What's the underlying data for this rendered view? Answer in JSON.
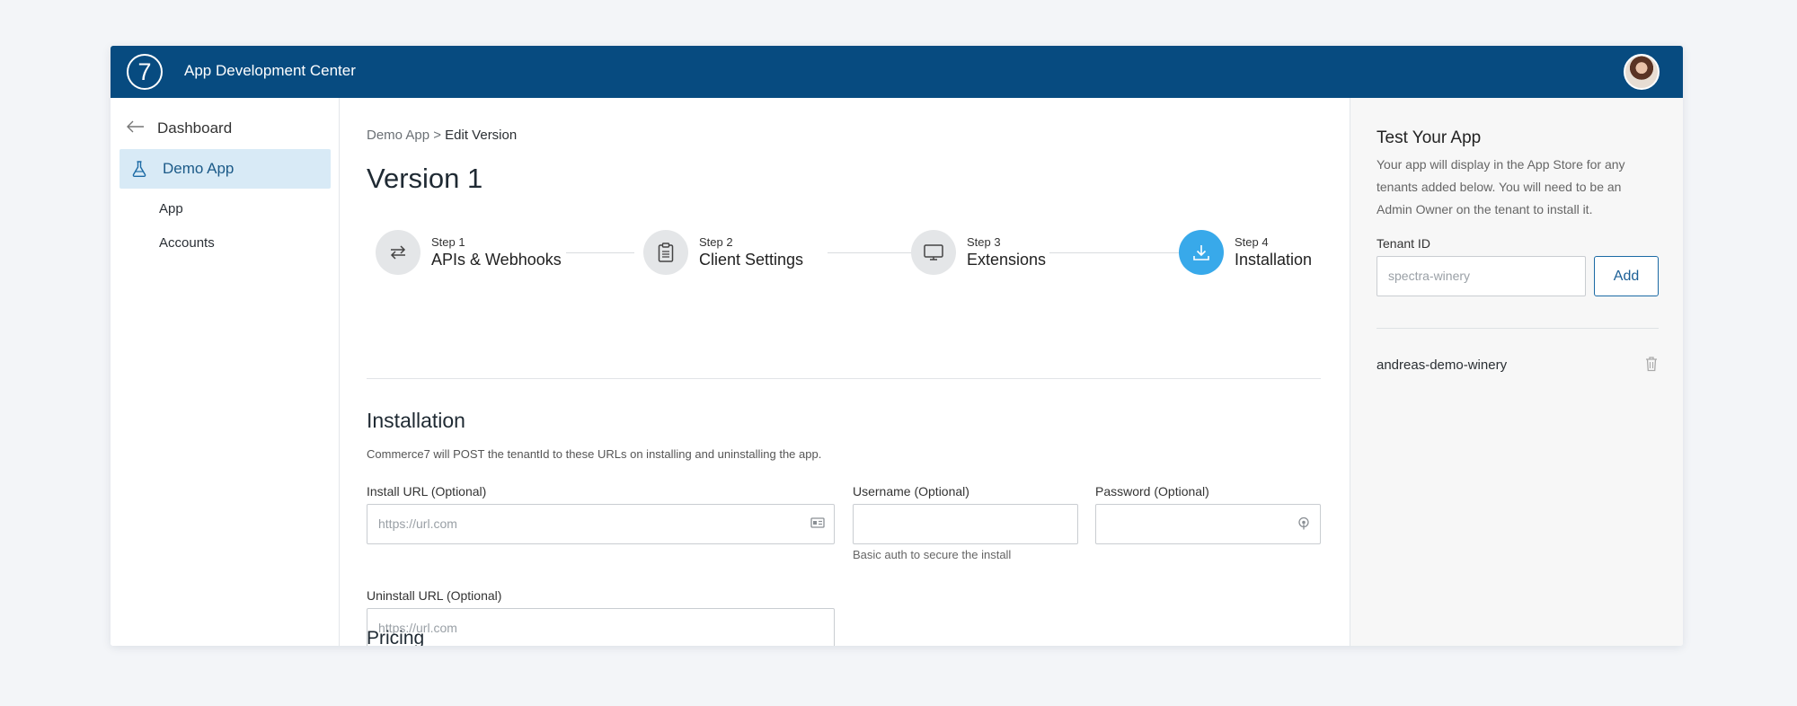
{
  "header": {
    "logo_text": "7",
    "title": "App Development Center"
  },
  "sidebar": {
    "back_label": "Dashboard",
    "active_app": "Demo App",
    "sub_items": [
      "App",
      "Accounts"
    ]
  },
  "main": {
    "breadcrumb": {
      "parent": "Demo App",
      "separator": ">",
      "current": "Edit Version"
    },
    "page_title": "Version 1",
    "steps": [
      {
        "num": "Step 1",
        "label": "APIs & Webhooks",
        "icon": "swap-arrows-icon",
        "active": false
      },
      {
        "num": "Step 2",
        "label": "Client Settings",
        "icon": "clipboard-icon",
        "active": false
      },
      {
        "num": "Step 3",
        "label": "Extensions",
        "icon": "monitor-icon",
        "active": false
      },
      {
        "num": "Step 4",
        "label": "Installation",
        "icon": "download-icon",
        "active": true
      }
    ],
    "installation": {
      "title": "Installation",
      "description": "Commerce7 will POST the tenantId to these URLs on installing and uninstalling the app.",
      "install_url": {
        "label": "Install URL (Optional)",
        "placeholder": "https://url.com"
      },
      "username": {
        "label": "Username (Optional)",
        "help": "Basic auth to secure the install"
      },
      "password": {
        "label": "Password (Optional)"
      },
      "uninstall_url": {
        "label": "Uninstall URL (Optional)",
        "placeholder": "https://url.com"
      }
    },
    "pricing_title": "Pricing"
  },
  "right_panel": {
    "title": "Test Your App",
    "description": "Your app will display in the App Store for any tenants added below. You will need to be an Admin Owner on the tenant to install it.",
    "tenant_label": "Tenant ID",
    "tenant_placeholder": "spectra-winery",
    "add_label": "Add",
    "tenants": [
      "andreas-demo-winery"
    ]
  },
  "colors": {
    "header_bg": "#074b80",
    "active_nav_bg": "#d8eaf6",
    "active_step": "#38a9ea",
    "add_button_border": "#1b6aa5"
  }
}
